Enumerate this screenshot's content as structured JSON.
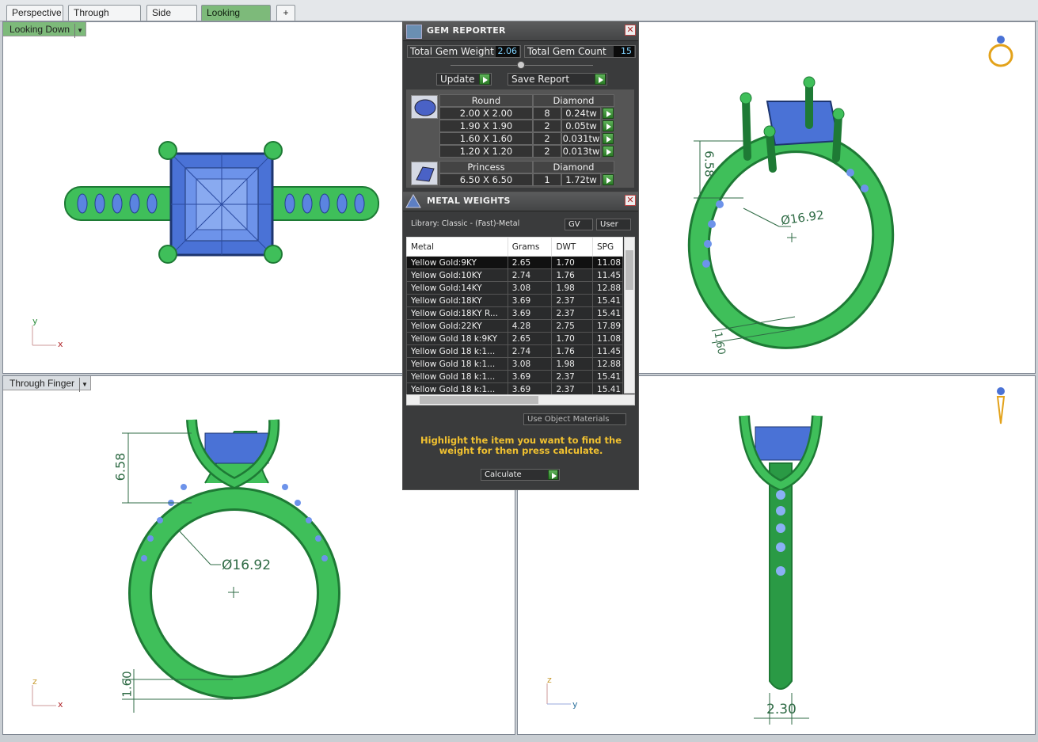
{
  "tabs": [
    "Perspective",
    "Through Finger",
    "Side View",
    "Looking Down"
  ],
  "add_tab": "+",
  "viewports": {
    "top_left": {
      "label": "Looking Down",
      "axis_v": "y",
      "axis_h": "x"
    },
    "top_right": {
      "dim_prong": "6.58",
      "dim_dia": "Ø16.92",
      "dim_band": "1.60"
    },
    "bottom_left": {
      "label": "Through Finger",
      "dim_prong": "6.58",
      "dim_dia": "Ø16.92",
      "dim_band": "1.60",
      "axis_v": "z",
      "axis_h": "x"
    },
    "bottom_right": {
      "dim_width": "2.30",
      "axis_v": "z",
      "axis_h": "y"
    }
  },
  "gem_reporter": {
    "title": "GEM REPORTER",
    "close": "✕",
    "total_weight_label": "Total Gem Weight",
    "total_weight": "2.06",
    "total_count_label": "Total Gem Count",
    "total_count": "15",
    "update": "Update",
    "save_report": "Save Report",
    "groups": [
      {
        "shape": "Round",
        "material": "Diamond",
        "rows": [
          {
            "size": "2.00 X 2.00",
            "qty": "8",
            "tw": "0.24tw"
          },
          {
            "size": "1.90 X 1.90",
            "qty": "2",
            "tw": "0.05tw"
          },
          {
            "size": "1.60 X 1.60",
            "qty": "2",
            "tw": "0.031tw"
          },
          {
            "size": "1.20 X 1.20",
            "qty": "2",
            "tw": "0.013tw"
          }
        ]
      },
      {
        "shape": "Princess",
        "material": "Diamond",
        "rows": [
          {
            "size": "6.50 X 6.50",
            "qty": "1",
            "tw": "1.72tw"
          }
        ]
      }
    ]
  },
  "metal_weights": {
    "title": "METAL WEIGHTS",
    "close": "✕",
    "library": "Library: Classic - (Fast)-Metal",
    "gv": "GV",
    "user": "User",
    "columns": [
      "Metal",
      "Grams",
      "DWT",
      "SPG"
    ],
    "rows": [
      [
        "Yellow Gold:9KY",
        "2.65",
        "1.70",
        "11.08"
      ],
      [
        "Yellow Gold:10KY",
        "2.74",
        "1.76",
        "11.45"
      ],
      [
        "Yellow Gold:14KY",
        "3.08",
        "1.98",
        "12.88"
      ],
      [
        "Yellow Gold:18KY",
        "3.69",
        "2.37",
        "15.41"
      ],
      [
        "Yellow Gold:18KY R...",
        "3.69",
        "2.37",
        "15.41"
      ],
      [
        "Yellow Gold:22KY",
        "4.28",
        "2.75",
        "17.89"
      ],
      [
        "Yellow Gold 18 k:9KY",
        "2.65",
        "1.70",
        "11.08"
      ],
      [
        "Yellow Gold 18 k:1...",
        "2.74",
        "1.76",
        "11.45"
      ],
      [
        "Yellow Gold 18 k:1...",
        "3.08",
        "1.98",
        "12.88"
      ],
      [
        "Yellow Gold 18 k:1...",
        "3.69",
        "2.37",
        "15.41"
      ],
      [
        "Yellow Gold 18 k:1...",
        "3.69",
        "2.37",
        "15.41"
      ]
    ],
    "use_object_materials": "Use Object Materials",
    "hint": "Highlight the item you want to find the weight for then press calculate.",
    "calculate": "Calculate"
  },
  "colors": {
    "metal": "#3fbf5a",
    "gem": "#4a72d6",
    "dim": "#2f6b45",
    "active_tab": "#7dba7a",
    "panel": "#3a3b3c",
    "hint": "#f2c230"
  }
}
